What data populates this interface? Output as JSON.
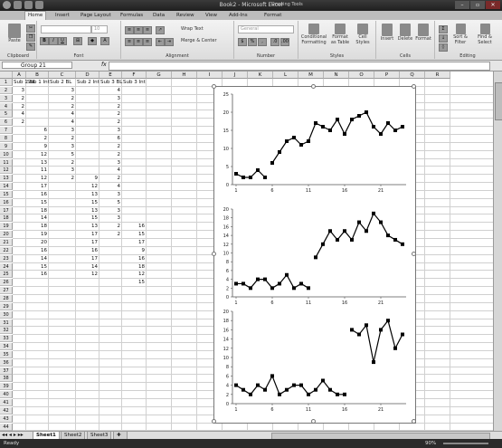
{
  "window": {
    "title": "Book2 - Microsoft Excel",
    "context_tab": "Drawing Tools",
    "buttons": [
      "–",
      "▫",
      "✕"
    ]
  },
  "ribbon_tabs": [
    "Home",
    "Insert",
    "Page Layout",
    "Formulas",
    "Data",
    "Review",
    "View",
    "Add-Ins",
    "Format"
  ],
  "ribbon": {
    "clipboard": {
      "paste": "Paste",
      "label": "Clipboard"
    },
    "font": {
      "name": "",
      "size": "10",
      "label": "Font"
    },
    "alignment": {
      "wrap": "Wrap Text",
      "merge": "Merge & Center",
      "label": "Alignment"
    },
    "number": {
      "format": "General",
      "symbols": [
        "$",
        "%",
        ",",
        ".0",
        ".00"
      ],
      "label": "Number"
    },
    "styles": {
      "cond": "Conditional Formatting",
      "table": "Format as Table",
      "cell": "Cell Styles",
      "label": "Styles"
    },
    "cells": {
      "insert": "Insert",
      "delete": "Delete",
      "format": "Format",
      "label": "Cells"
    },
    "editing": {
      "sort": "Sort & Filter",
      "find": "Find & Select",
      "label": "Editing"
    }
  },
  "formula_bar": {
    "name_box": "Group 21",
    "fx": "fx",
    "value": ""
  },
  "columns": [
    "A",
    "B",
    "C",
    "D",
    "E",
    "F",
    "G",
    "H",
    "I",
    "J",
    "K",
    "L",
    "M",
    "N",
    "O",
    "P",
    "Q",
    "R"
  ],
  "rows": [
    "1",
    "2",
    "3",
    "4",
    "5",
    "6",
    "7",
    "8",
    "9",
    "10",
    "11",
    "12",
    "13",
    "14",
    "15",
    "16",
    "17",
    "18",
    "19",
    "20",
    "21",
    "22",
    "23",
    "24",
    "25",
    "26",
    "27",
    "28",
    "29",
    "30",
    "31",
    "32",
    "33",
    "34",
    "35",
    "36",
    "37",
    "38",
    "39",
    "40",
    "41",
    "42",
    "43",
    "44",
    "45"
  ],
  "sheet": {
    "headers": [
      "Sub 1 BL",
      "Sub 1 Int",
      "Sub 2 BL",
      "Sub 2 Int",
      "Sub 3 BL",
      "Sub 3 Int"
    ],
    "col_A": [
      "3",
      "2",
      "2",
      "4",
      "2"
    ],
    "col_B": [
      "6",
      "2",
      "9",
      "12",
      "13",
      "11",
      "12",
      "17",
      "16",
      "15",
      "18",
      "14",
      "18",
      "19",
      "20",
      "16",
      "14",
      "15",
      "16"
    ],
    "col_C": [
      "3",
      "2",
      "2",
      "4",
      "4",
      "3",
      "2",
      "3",
      "5",
      "2",
      "3",
      "2"
    ],
    "col_D": [
      "9",
      "12",
      "13",
      "15",
      "13",
      "15",
      "13",
      "17",
      "17",
      "16",
      "17",
      "14",
      "12"
    ],
    "col_E": [
      "4",
      "3",
      "2",
      "2",
      "2",
      "3",
      "6",
      "2",
      "2",
      "3",
      "4",
      "2",
      "4",
      "3",
      "5",
      "3",
      "3",
      "2",
      "2"
    ],
    "col_F": [
      "16",
      "15",
      "17",
      "9",
      "16",
      "18",
      "12",
      "15"
    ]
  },
  "chart_data": [
    {
      "type": "line",
      "title": "",
      "xlabel": "",
      "ylabel": "",
      "ylim": [
        0,
        25
      ],
      "yticks": [
        "0",
        "5",
        "10",
        "15",
        "20",
        "25"
      ],
      "xticks": [
        "1",
        "6",
        "11",
        "16",
        "21"
      ],
      "series": [
        {
          "x": [
            1,
            2,
            3,
            4,
            5
          ],
          "values": [
            3,
            2,
            2,
            4,
            2
          ]
        },
        {
          "x": [
            6,
            7,
            8,
            9,
            10,
            11,
            12,
            13,
            14,
            15,
            16,
            17,
            18,
            19,
            20,
            21,
            22,
            23,
            24
          ],
          "values": [
            6,
            9,
            12,
            13,
            11,
            12,
            17,
            16,
            15,
            18,
            14,
            18,
            19,
            20,
            16,
            14,
            17,
            15,
            16
          ]
        }
      ]
    },
    {
      "type": "line",
      "title": "",
      "xlabel": "",
      "ylabel": "",
      "ylim": [
        0,
        20
      ],
      "yticks": [
        "0",
        "2",
        "4",
        "6",
        "8",
        "10",
        "12",
        "14",
        "16",
        "18",
        "20"
      ],
      "xticks": [
        "1",
        "6",
        "11",
        "16",
        "21"
      ],
      "series": [
        {
          "x": [
            1,
            2,
            3,
            4,
            5,
            6,
            7,
            8,
            9,
            10,
            11,
            12
          ],
          "values": [
            3,
            3,
            2,
            4,
            4,
            2,
            3,
            5,
            2,
            3,
            2,
            null
          ]
        },
        {
          "x": [
            12,
            13,
            14,
            15,
            16,
            17,
            18,
            19,
            20,
            21,
            22,
            23,
            24
          ],
          "values": [
            9,
            12,
            15,
            13,
            15,
            13,
            17,
            15,
            19,
            17,
            14,
            13,
            12
          ]
        }
      ]
    },
    {
      "type": "line",
      "title": "",
      "xlabel": "",
      "ylabel": "",
      "ylim": [
        0,
        20
      ],
      "yticks": [
        "0",
        "2",
        "4",
        "6",
        "8",
        "10",
        "12",
        "14",
        "16",
        "18",
        "20"
      ],
      "xticks": [
        "1",
        "6",
        "11",
        "16",
        "21"
      ],
      "series": [
        {
          "x": [
            1,
            2,
            3,
            4,
            5,
            6,
            7,
            8,
            9,
            10,
            11,
            12,
            13,
            14,
            15,
            16
          ],
          "values": [
            4,
            3,
            2,
            4,
            3,
            6,
            2,
            3,
            4,
            4,
            2,
            3,
            5,
            3,
            2,
            2
          ]
        },
        {
          "x": [
            17,
            18,
            19,
            20,
            21,
            22,
            23,
            24
          ],
          "values": [
            16,
            15,
            17,
            9,
            16,
            18,
            12,
            15
          ]
        }
      ]
    }
  ],
  "sheet_tabs": [
    "Sheet1",
    "Sheet2",
    "Sheet3"
  ],
  "status": {
    "ready": "Ready",
    "zoom": "90%"
  }
}
